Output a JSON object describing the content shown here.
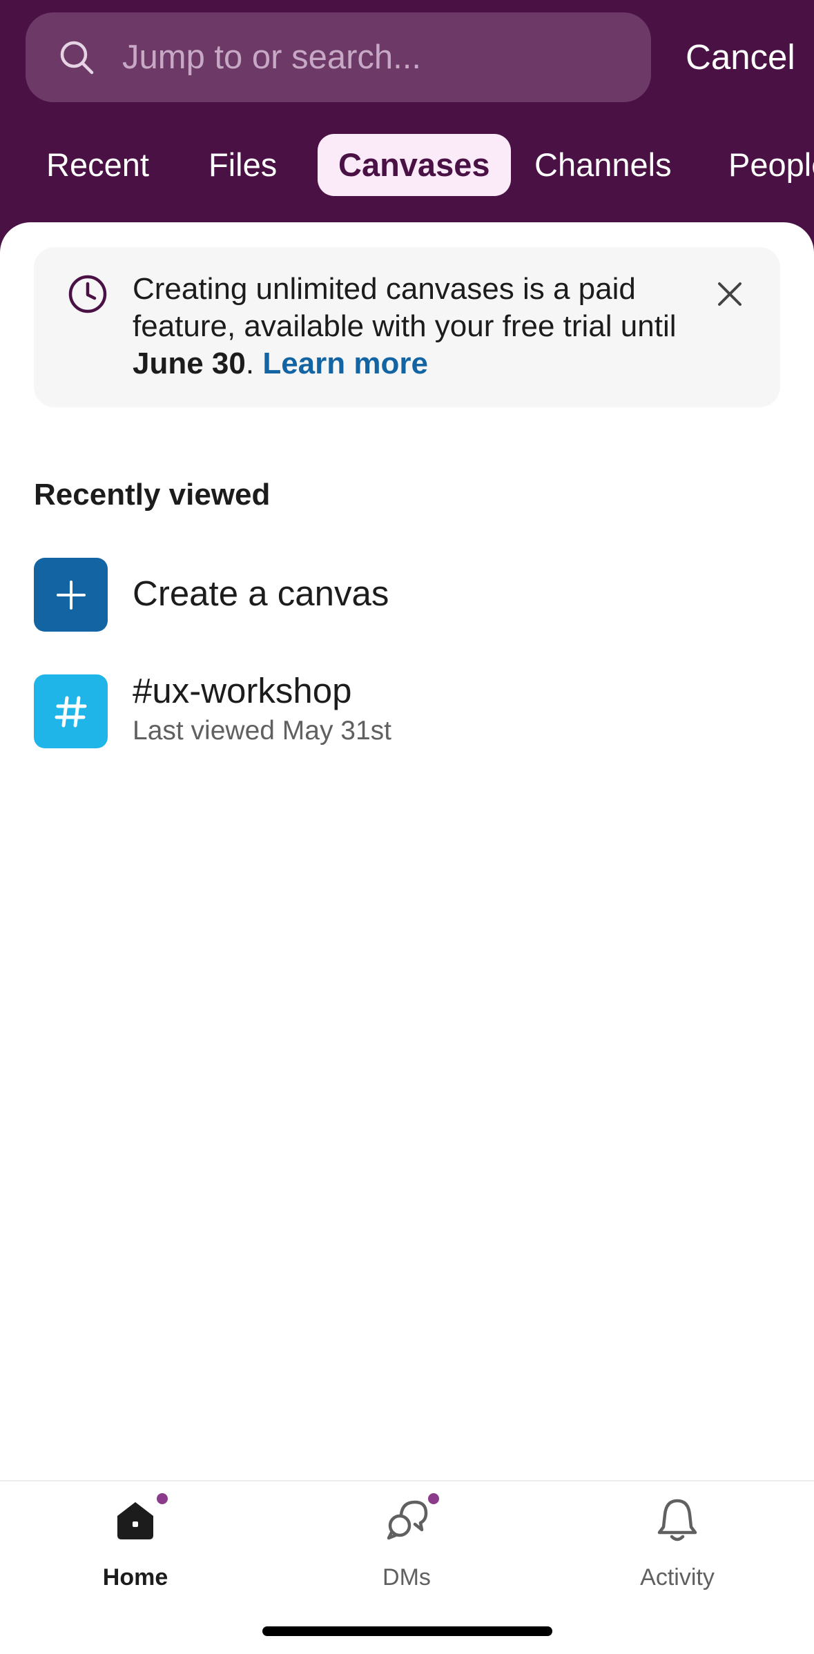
{
  "search": {
    "placeholder": "Jump to or search...",
    "cancel_label": "Cancel"
  },
  "tabs": [
    {
      "label": "Recent"
    },
    {
      "label": "Files"
    },
    {
      "label": "Canvases",
      "active": true
    },
    {
      "label": "Channels"
    },
    {
      "label": "People"
    }
  ],
  "banner": {
    "text_1": "Creating unlimited canvases is a paid feature, available with your free trial until ",
    "date": "June 30",
    "text_2": ". ",
    "link": "Learn more",
    "icon": "clock-icon",
    "close_icon": "close-icon"
  },
  "section": {
    "title": "Recently viewed"
  },
  "items": [
    {
      "title": "Create a canvas",
      "icon": "plus-icon",
      "color": "#1264a3"
    },
    {
      "title": "#ux-workshop",
      "subtitle": "Last viewed May 31st",
      "icon": "hash-icon",
      "color": "#1fb5e8"
    }
  ],
  "tabbar": [
    {
      "label": "Home",
      "icon": "home-icon",
      "active": true,
      "badge": true
    },
    {
      "label": "DMs",
      "icon": "dms-icon",
      "active": false,
      "badge": true
    },
    {
      "label": "Activity",
      "icon": "bell-icon",
      "active": false,
      "badge": false
    }
  ],
  "colors": {
    "header_bg": "#4a1145",
    "accent": "#1264a3",
    "badge": "#8b3b8b"
  }
}
